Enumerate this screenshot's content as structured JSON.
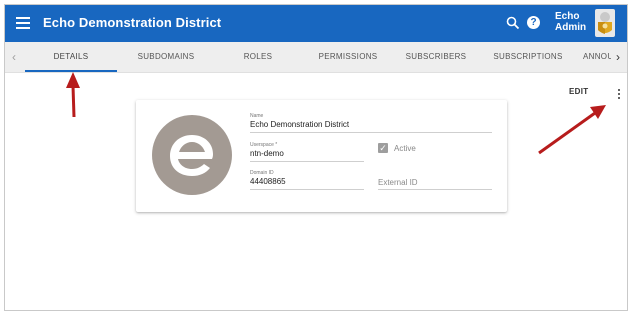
{
  "app": {
    "title": "Echo Demonstration District",
    "user_name_line1": "Echo",
    "user_name_line2": "Admin"
  },
  "tabs": [
    {
      "label": "DETAILS",
      "active": true
    },
    {
      "label": "SUBDOMAINS",
      "active": false
    },
    {
      "label": "ROLES",
      "active": false
    },
    {
      "label": "PERMISSIONS",
      "active": false
    },
    {
      "label": "SUBSCRIBERS",
      "active": false
    },
    {
      "label": "SUBSCRIPTIONS",
      "active": false
    },
    {
      "label": "ANNOU",
      "active": false
    }
  ],
  "toolbar": {
    "edit_label": "EDIT"
  },
  "details": {
    "name_label": "Name",
    "name_value": "Echo Demonstration District",
    "userspace_label": "Userspace *",
    "userspace_value": "ntn-demo",
    "active_label": "Active",
    "active_checked": true,
    "domain_id_label": "Domain ID",
    "domain_id_value": "44408865",
    "external_id_label": "External ID",
    "external_id_value": ""
  },
  "colors": {
    "brand": "#1867c0",
    "arrow": "#b71c1c",
    "logo": "#a39a93"
  },
  "icons": [
    "menu-icon",
    "search-icon",
    "help-icon",
    "avatar",
    "chevron-left-icon",
    "chevron-right-icon",
    "more-vert-icon",
    "domain-logo"
  ]
}
